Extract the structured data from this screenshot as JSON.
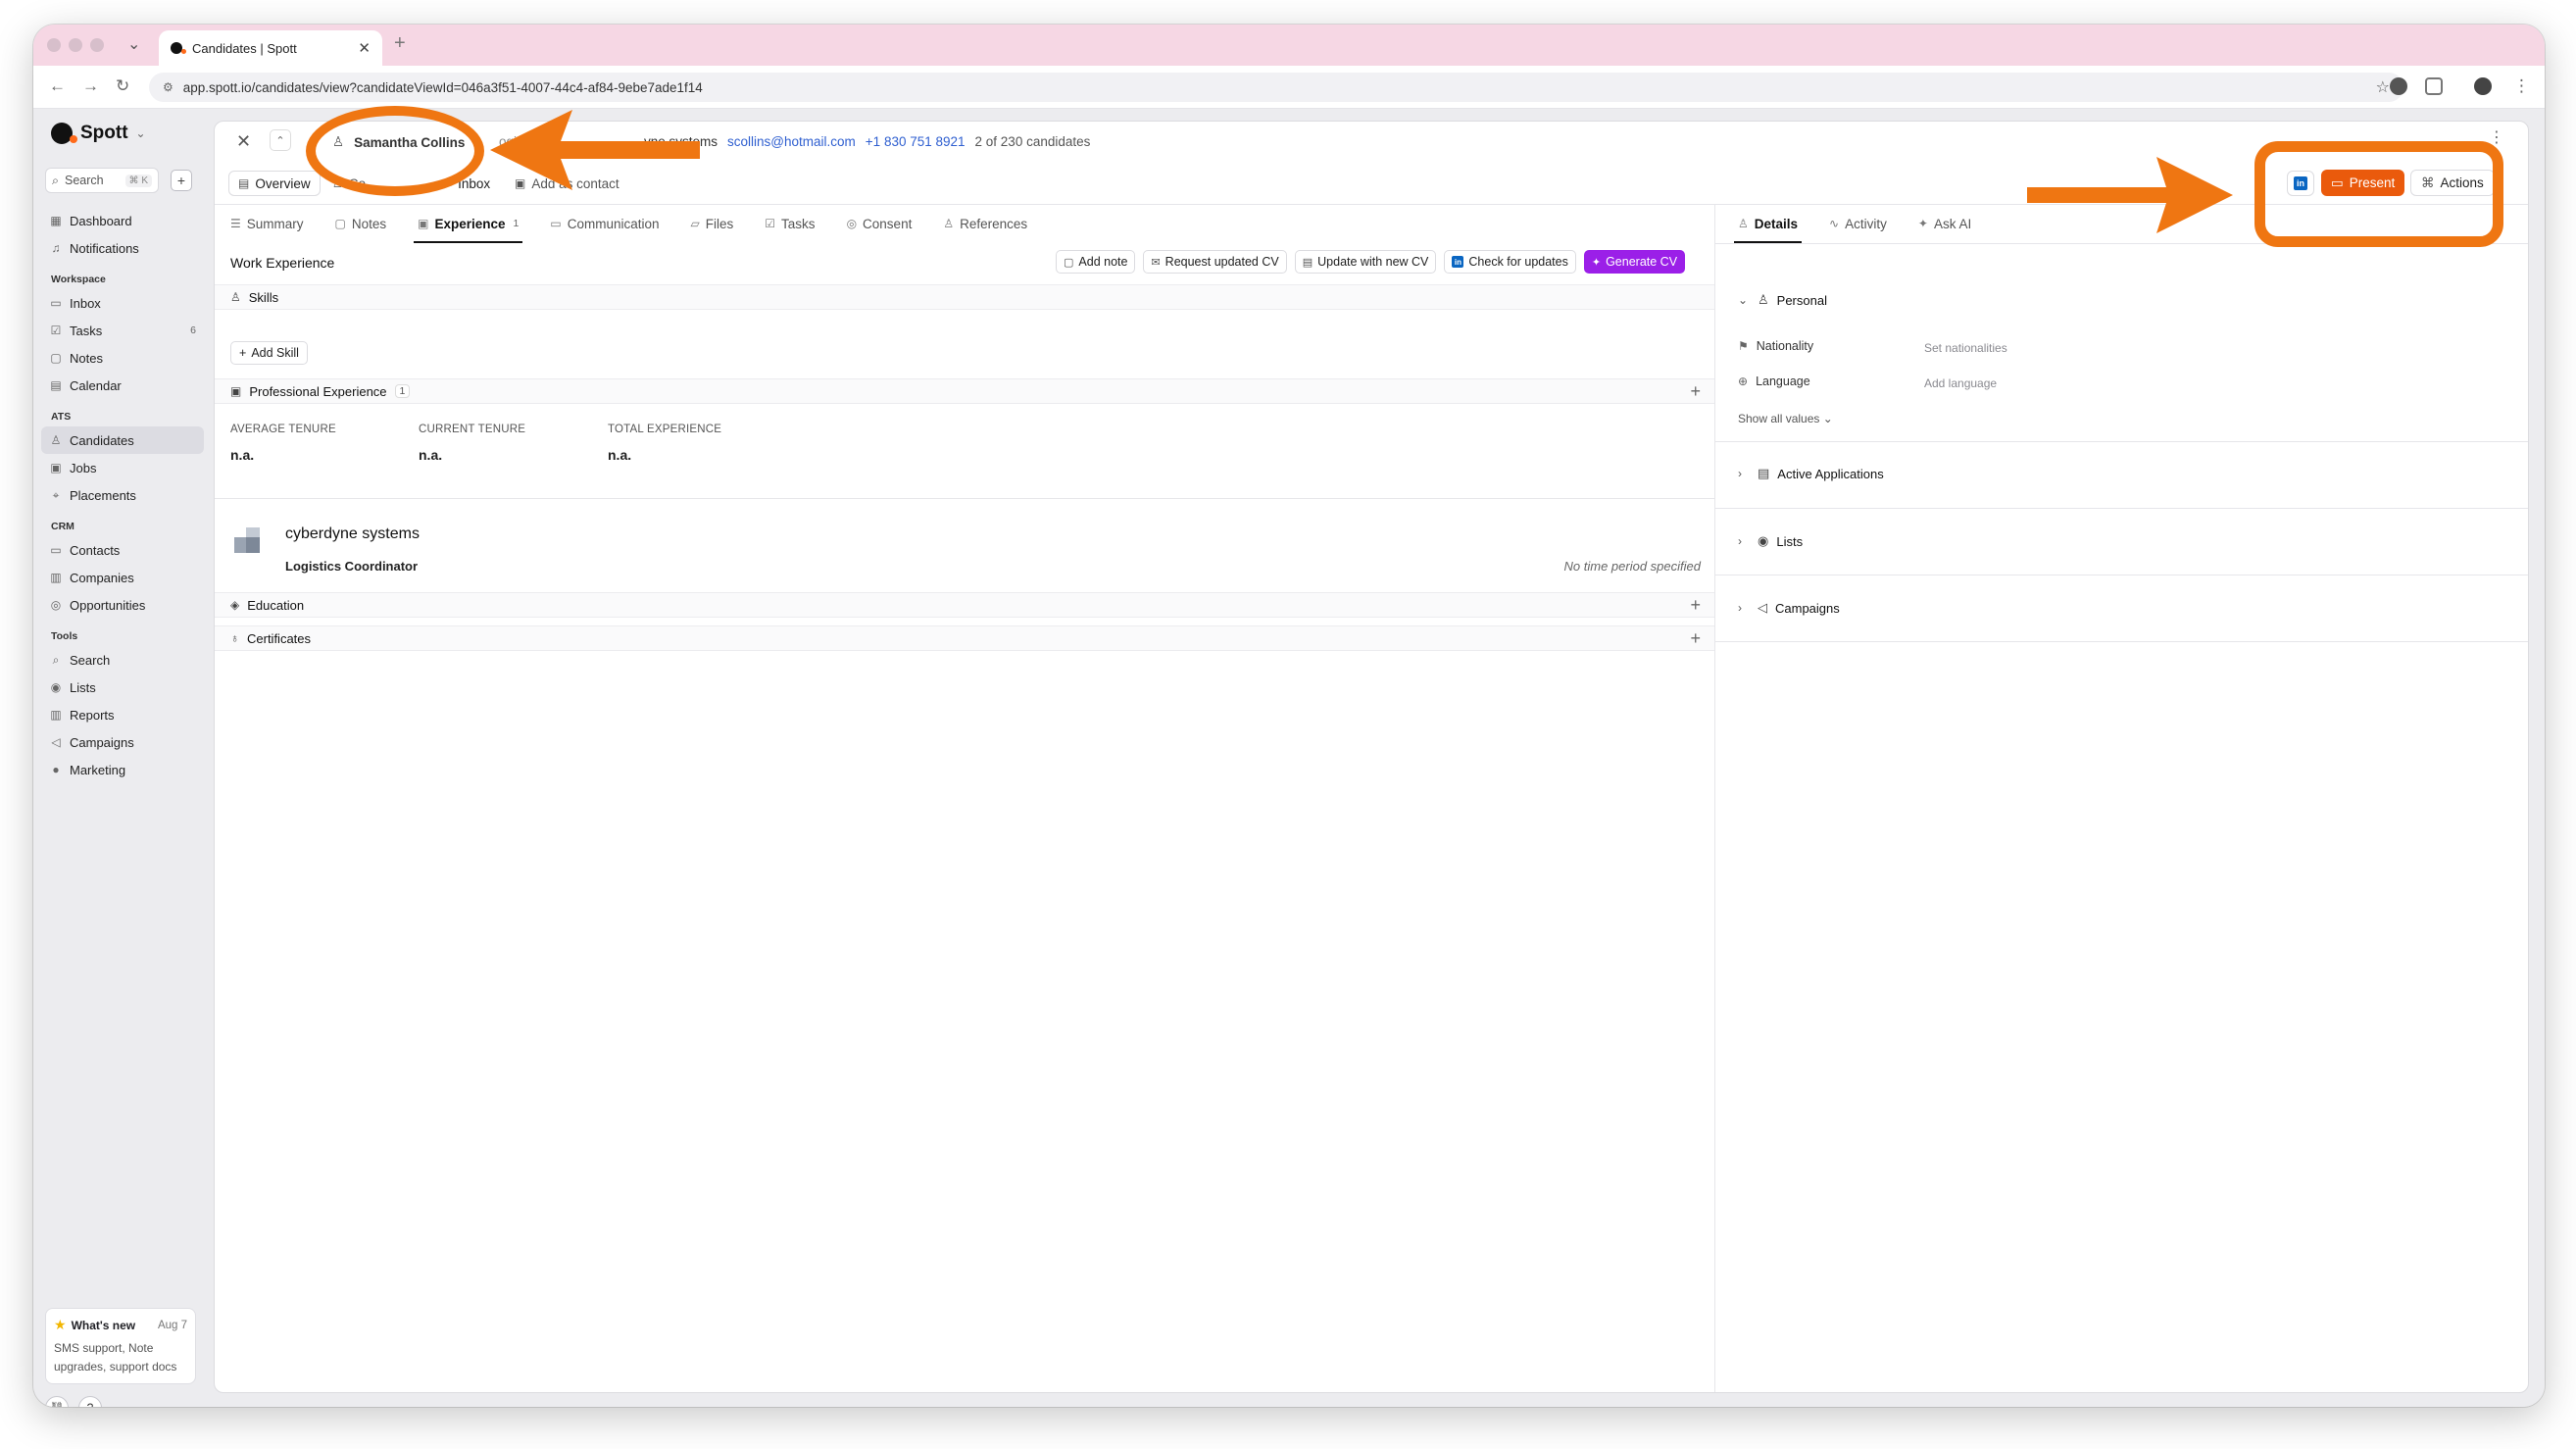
{
  "browser": {
    "tab_title": "Candidates | Spott",
    "url": "app.spott.io/candidates/view?candidateViewId=046a3f51-4007-44c4-af84-9ebe7ade1f14"
  },
  "sidebar": {
    "brand": "Spott",
    "search_label": "Search",
    "search_shortcut": "⌘ K",
    "top_items": [
      {
        "label": "Dashboard",
        "icon": "dashboard-icon"
      },
      {
        "label": "Notifications",
        "icon": "bell-icon"
      }
    ],
    "sections": [
      {
        "title": "Workspace",
        "items": [
          {
            "label": "Inbox",
            "icon": "inbox-icon"
          },
          {
            "label": "Tasks",
            "icon": "tasks-icon",
            "badge": "6"
          },
          {
            "label": "Notes",
            "icon": "notes-icon"
          },
          {
            "label": "Calendar",
            "icon": "calendar-icon"
          }
        ]
      },
      {
        "title": "ATS",
        "items": [
          {
            "label": "Candidates",
            "icon": "user-icon",
            "active": true
          },
          {
            "label": "Jobs",
            "icon": "briefcase-icon"
          },
          {
            "label": "Placements",
            "icon": "placement-icon"
          }
        ]
      },
      {
        "title": "CRM",
        "items": [
          {
            "label": "Contacts",
            "icon": "contacts-icon"
          },
          {
            "label": "Companies",
            "icon": "building-icon"
          },
          {
            "label": "Opportunities",
            "icon": "opportunity-icon"
          }
        ]
      },
      {
        "title": "Tools",
        "items": [
          {
            "label": "Search",
            "icon": "search-icon"
          },
          {
            "label": "Lists",
            "icon": "list-icon"
          },
          {
            "label": "Reports",
            "icon": "chart-icon"
          },
          {
            "label": "Campaigns",
            "icon": "megaphone-icon"
          },
          {
            "label": "Marketing",
            "icon": "marketing-icon"
          }
        ]
      }
    ],
    "whats_new": {
      "title": "What's new",
      "date": "Aug 7",
      "body": "SMS support, Note upgrades, support docs"
    }
  },
  "candidate_bar": {
    "name": "Samantha Collins",
    "title_fragment": "ogi",
    "company_fragment": "yne systems",
    "email": "scollins@hotmail.com",
    "phone": "+1 830 751 8921",
    "position": "2 of 230 candidates"
  },
  "subbar": {
    "overview": "Overview",
    "second_chip": "Co",
    "inbox": "Inbox",
    "add_contact": "Add as contact",
    "present": "Present",
    "actions": "Actions"
  },
  "tabs": [
    {
      "label": "Summary",
      "icon": "summary-icon"
    },
    {
      "label": "Notes",
      "icon": "notes-icon"
    },
    {
      "label": "Experience",
      "icon": "briefcase-icon",
      "count": "1",
      "active": true
    },
    {
      "label": "Communication",
      "icon": "message-icon"
    },
    {
      "label": "Files",
      "icon": "folder-icon"
    },
    {
      "label": "Tasks",
      "icon": "tasks-icon"
    },
    {
      "label": "Consent",
      "icon": "consent-icon"
    },
    {
      "label": "References",
      "icon": "references-icon"
    }
  ],
  "right_tabs": [
    {
      "label": "Details",
      "icon": "details-icon",
      "active": true
    },
    {
      "label": "Activity",
      "icon": "activity-icon"
    },
    {
      "label": "Ask AI",
      "icon": "sparkle-icon"
    }
  ],
  "experience": {
    "title": "Work Experience",
    "buttons": {
      "add_note": "Add note",
      "request_cv": "Request updated CV",
      "update_cv": "Update with new CV",
      "check_updates": "Check for updates",
      "generate_cv": "Generate CV"
    },
    "skills_label": "Skills",
    "add_skill": "Add Skill",
    "professional_label": "Professional Experience",
    "professional_count": "1",
    "stats": [
      {
        "label": "AVERAGE TENURE",
        "value": "n.a."
      },
      {
        "label": "CURRENT TENURE",
        "value": "n.a."
      },
      {
        "label": "TOTAL EXPERIENCE",
        "value": "n.a."
      }
    ],
    "entry": {
      "company": "cyberdyne systems",
      "role": "Logistics Coordinator",
      "period": "No time period specified"
    },
    "education_label": "Education",
    "certificates_label": "Certificates"
  },
  "details": {
    "personal": "Personal",
    "fields": [
      {
        "label": "Nationality",
        "value": "Set nationalities"
      },
      {
        "label": "Language",
        "value": "Add language"
      }
    ],
    "show_all": "Show all values",
    "sections": [
      "Active Applications",
      "Lists",
      "Campaigns"
    ]
  },
  "colors": {
    "accent_orange": "#ea5a0c",
    "annotation_orange": "#ef7612",
    "generate_purple": "#9b1fe8",
    "link_blue": "#2f5fd0",
    "tabstrip_pink": "#f6d7e4"
  }
}
